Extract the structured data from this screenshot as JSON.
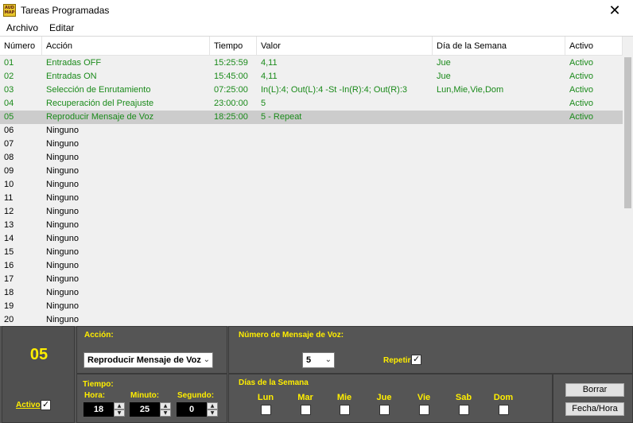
{
  "window": {
    "title": "Tareas Programadas",
    "icon_lines": [
      "AUD",
      "MAP"
    ],
    "close_glyph": "✕"
  },
  "menu": [
    "Archivo",
    "Editar"
  ],
  "table": {
    "columns": [
      "Número",
      "Acción",
      "Tiempo",
      "Valor",
      "Día de la Semana",
      "Activo"
    ],
    "rows": [
      {
        "num": "01",
        "accion": "Entradas OFF",
        "tiempo": "15:25:59",
        "valor": "4,11",
        "dia": "Jue",
        "activo": "Activo",
        "style": "green"
      },
      {
        "num": "02",
        "accion": "Entradas ON",
        "tiempo": "15:45:00",
        "valor": "4,11",
        "dia": "Jue",
        "activo": "Activo",
        "style": "green"
      },
      {
        "num": "03",
        "accion": "Selección de Enrutamiento",
        "tiempo": "07:25:00",
        "valor": "In(L):4; Out(L):4 -St -In(R):4; Out(R):3",
        "dia": "Lun,Mie,Vie,Dom",
        "activo": "Activo",
        "style": "green"
      },
      {
        "num": "04",
        "accion": "Recuperación del Preajuste",
        "tiempo": "23:00:00",
        "valor": "5",
        "dia": "",
        "activo": "Activo",
        "style": "green"
      },
      {
        "num": "05",
        "accion": "Reproducir Mensaje de Voz",
        "tiempo": "18:25:00",
        "valor": "5 - Repeat",
        "dia": "",
        "activo": "Activo",
        "style": "green selected"
      },
      {
        "num": "06",
        "accion": "Ninguno",
        "tiempo": "",
        "valor": "",
        "dia": "",
        "activo": "",
        "style": ""
      },
      {
        "num": "07",
        "accion": "Ninguno",
        "tiempo": "",
        "valor": "",
        "dia": "",
        "activo": "",
        "style": ""
      },
      {
        "num": "08",
        "accion": "Ninguno",
        "tiempo": "",
        "valor": "",
        "dia": "",
        "activo": "",
        "style": ""
      },
      {
        "num": "09",
        "accion": "Ninguno",
        "tiempo": "",
        "valor": "",
        "dia": "",
        "activo": "",
        "style": ""
      },
      {
        "num": "10",
        "accion": "Ninguno",
        "tiempo": "",
        "valor": "",
        "dia": "",
        "activo": "",
        "style": ""
      },
      {
        "num": "11",
        "accion": "Ninguno",
        "tiempo": "",
        "valor": "",
        "dia": "",
        "activo": "",
        "style": ""
      },
      {
        "num": "12",
        "accion": "Ninguno",
        "tiempo": "",
        "valor": "",
        "dia": "",
        "activo": "",
        "style": ""
      },
      {
        "num": "13",
        "accion": "Ninguno",
        "tiempo": "",
        "valor": "",
        "dia": "",
        "activo": "",
        "style": ""
      },
      {
        "num": "14",
        "accion": "Ninguno",
        "tiempo": "",
        "valor": "",
        "dia": "",
        "activo": "",
        "style": ""
      },
      {
        "num": "15",
        "accion": "Ninguno",
        "tiempo": "",
        "valor": "",
        "dia": "",
        "activo": "",
        "style": ""
      },
      {
        "num": "16",
        "accion": "Ninguno",
        "tiempo": "",
        "valor": "",
        "dia": "",
        "activo": "",
        "style": ""
      },
      {
        "num": "17",
        "accion": "Ninguno",
        "tiempo": "",
        "valor": "",
        "dia": "",
        "activo": "",
        "style": ""
      },
      {
        "num": "18",
        "accion": "Ninguno",
        "tiempo": "",
        "valor": "",
        "dia": "",
        "activo": "",
        "style": ""
      },
      {
        "num": "19",
        "accion": "Ninguno",
        "tiempo": "",
        "valor": "",
        "dia": "",
        "activo": "",
        "style": ""
      },
      {
        "num": "20",
        "accion": "Ninguno",
        "tiempo": "",
        "valor": "",
        "dia": "",
        "activo": "",
        "style": ""
      }
    ]
  },
  "editor": {
    "selected_number": "05",
    "activo_label": "Activo",
    "activo_checked": true,
    "accion_label": "Acción:",
    "accion_value": "Reproducir Mensaje de Voz",
    "mensaje_label": "Número de Mensaje de Voz:",
    "mensaje_value": "5",
    "repetir_label": "Repetir",
    "repetir_checked": true,
    "tiempo_label": "Tiempo:",
    "hora_label": "Hora:",
    "hora_value": "18",
    "minuto_label": "Minuto:",
    "minuto_value": "25",
    "segundo_label": "Segundo:",
    "segundo_value": "0",
    "dias_label": "Días de la Semana",
    "dias": [
      "Lun",
      "Mar",
      "Mie",
      "Jue",
      "Vie",
      "Sab",
      "Dom"
    ],
    "borrar_label": "Borrar",
    "fechahora_label": "Fecha/Hora"
  },
  "colors": {
    "accent_yellow": "#ffee00",
    "active_green": "#1a8a1a",
    "panel_gray": "#555555",
    "selected_row": "#cccccc"
  }
}
